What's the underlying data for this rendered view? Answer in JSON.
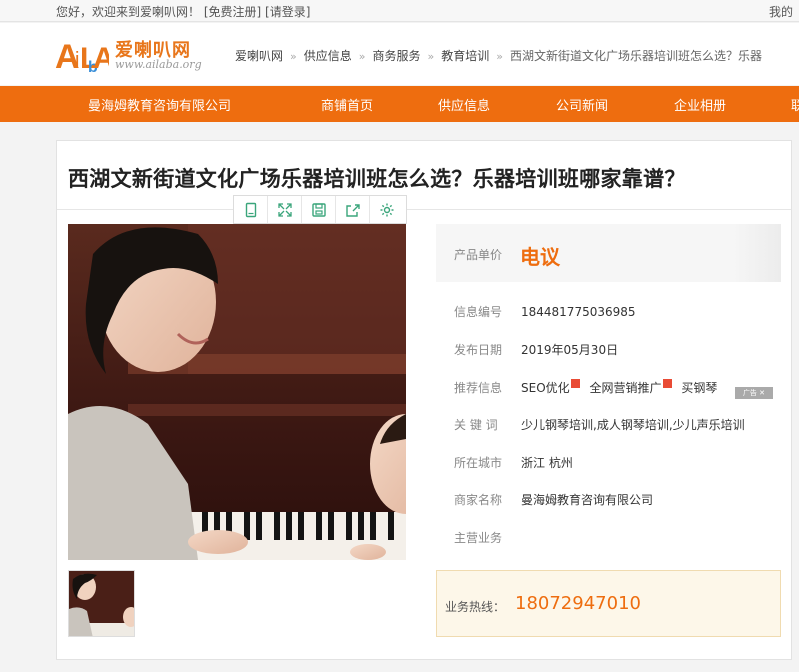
{
  "topbar": {
    "welcome": "您好，欢迎来到爱喇叭网！",
    "register": "[免费注册]",
    "login": "[请登录]",
    "right": "我的"
  },
  "logo": {
    "cn": "爱喇叭网",
    "en": "www.ailaba.org",
    "mark_text": "AiLbA",
    "brand_color": "#e8761b"
  },
  "breadcrumb": {
    "items": [
      "爱喇叭网",
      "供应信息",
      "商务服务",
      "教育培训",
      "西湖文新街道文化广场乐器培训班怎么选？乐器"
    ],
    "separator": "»"
  },
  "nav": {
    "accent": "#ee6d0f",
    "items": [
      "曼海姆教育咨询有限公司",
      "商铺首页",
      "供应信息",
      "公司新闻",
      "企业相册",
      "联"
    ]
  },
  "product": {
    "title": "西湖文新街道文化广场乐器培训班怎么选？乐器培训班哪家靠谱？",
    "toolbar_icons": [
      "phone-icon",
      "expand-icon",
      "save-icon",
      "share-icon",
      "settings-icon"
    ],
    "price_label": "产品单价",
    "price_value": "电议",
    "info": {
      "id_label": "信息编号",
      "id_value": "184481775036985",
      "date_label": "发布日期",
      "date_value": "2019年05月30日",
      "rec_label": "推荐信息",
      "rec_items": [
        "SEO优化",
        "全网营销推广",
        "买钢琴"
      ],
      "ad_tag": "广告",
      "keywords_label": "关 键 词",
      "keywords_value": "少儿钢琴培训,成人钢琴培训,少儿声乐培训",
      "city_label": "所在城市",
      "city_value": "浙江 杭州",
      "company_label": "商家名称",
      "company_value": "曼海姆教育咨询有限公司",
      "business_label": "主营业务",
      "business_value": ""
    },
    "hotline_label": "业务热线：",
    "hotline_value": "18072947010"
  }
}
